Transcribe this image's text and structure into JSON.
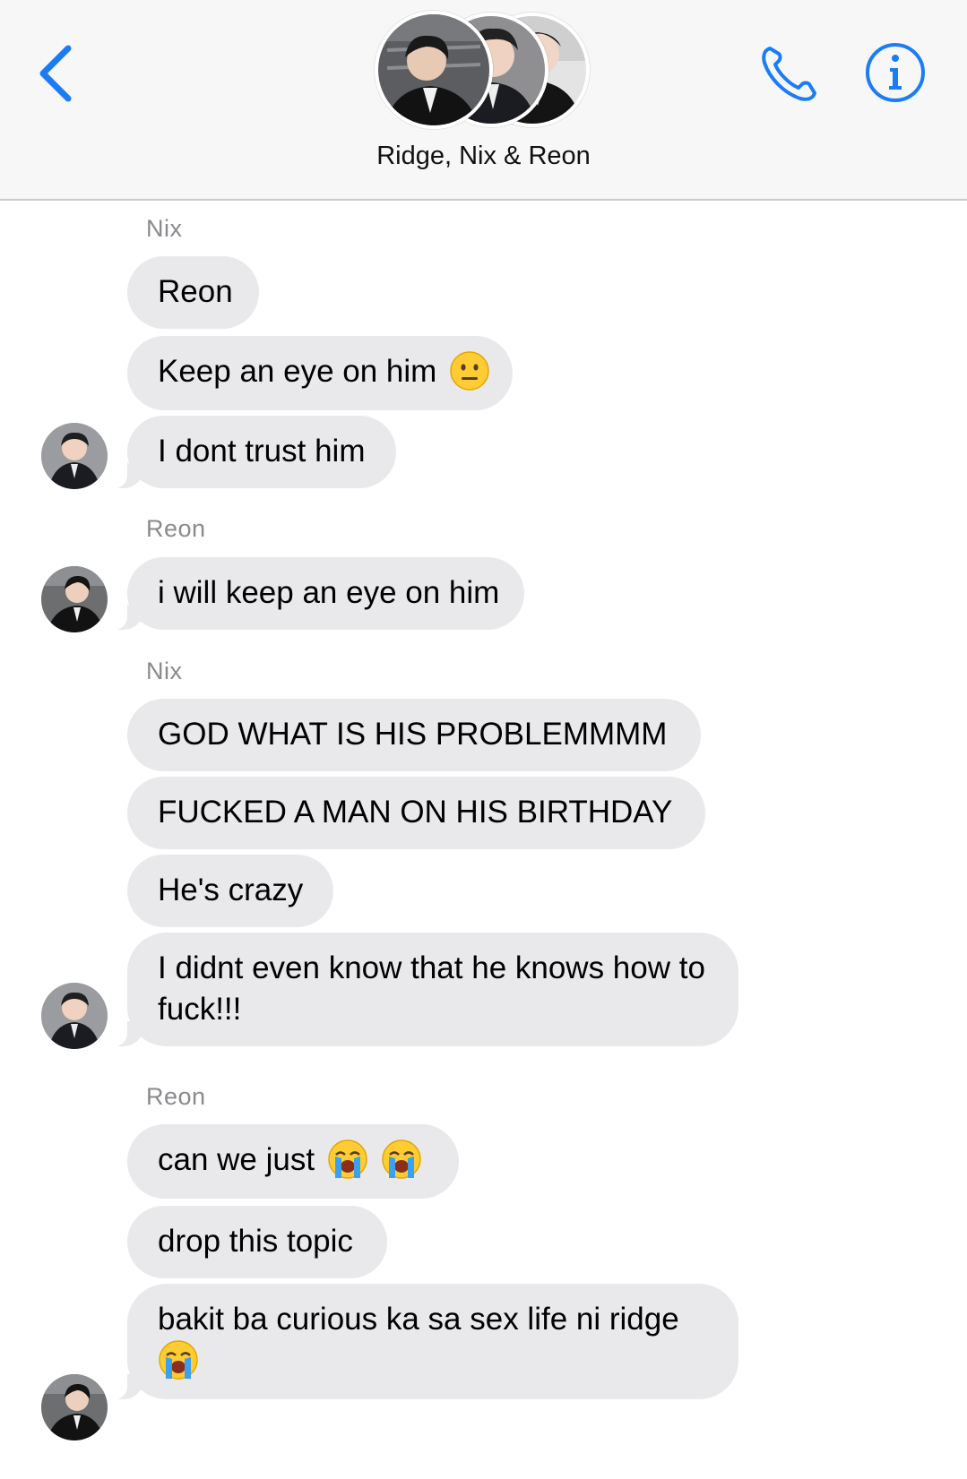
{
  "header": {
    "title": "Ridge, Nix & Reon",
    "colors": {
      "accent": "#1b7cf5",
      "bubble": "#e9e9eb",
      "sender": "#8a8a8e"
    },
    "icons": [
      "chevron-left-icon",
      "phone-icon",
      "info-icon"
    ]
  },
  "thread": {
    "groups": [
      {
        "sender": "Nix",
        "messages": [
          {
            "text": "Reon",
            "emoji": []
          },
          {
            "text": "Keep an eye on him",
            "emoji": [
              "neutral-face"
            ]
          },
          {
            "text": "I dont trust him",
            "emoji": []
          }
        ]
      },
      {
        "sender": "Reon",
        "messages": [
          {
            "text": "i will keep an eye on him",
            "emoji": []
          }
        ]
      },
      {
        "sender": "Nix",
        "messages": [
          {
            "text": "GOD WHAT IS HIS PROBLEMMMM",
            "emoji": []
          },
          {
            "text": "FUCKED A MAN ON HIS BIRTHDAY",
            "emoji": []
          },
          {
            "text": "He's crazy",
            "emoji": []
          },
          {
            "text": "I didnt even know that he knows how to fuck!!!",
            "emoji": []
          }
        ]
      },
      {
        "sender": "Reon",
        "messages": [
          {
            "text": "can we just",
            "emoji": [
              "loudly-crying-face",
              "loudly-crying-face"
            ]
          },
          {
            "text": "drop this topic",
            "emoji": []
          },
          {
            "text": "bakit ba curious ka sa sex life ni ridge",
            "emoji": [
              "loudly-crying-face"
            ]
          }
        ]
      }
    ]
  }
}
